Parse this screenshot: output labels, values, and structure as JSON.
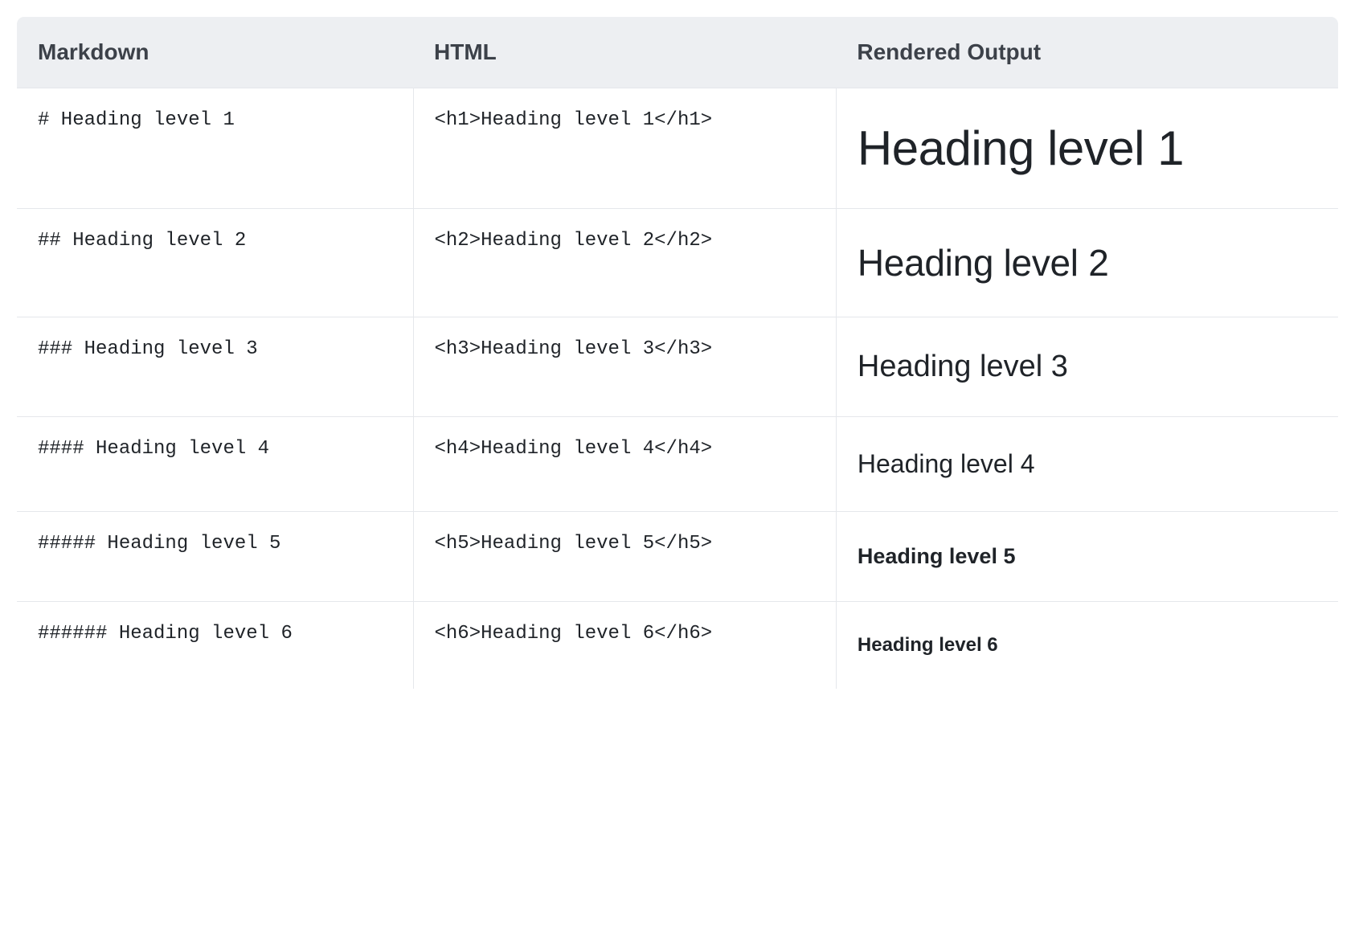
{
  "table": {
    "headers": [
      "Markdown",
      "HTML",
      "Rendered Output"
    ],
    "rows": [
      {
        "markdown": "# Heading level 1",
        "html": "<h1>Heading level 1</h1>",
        "rendered": "Heading level 1",
        "cls": "h1r"
      },
      {
        "markdown": "## Heading level 2",
        "html": "<h2>Heading level 2</h2>",
        "rendered": "Heading level 2",
        "cls": "h2r"
      },
      {
        "markdown": "### Heading level 3",
        "html": "<h3>Heading level 3</h3>",
        "rendered": "Heading level 3",
        "cls": "h3r"
      },
      {
        "markdown": "#### Heading level 4",
        "html": "<h4>Heading level 4</h4>",
        "rendered": "Heading level 4",
        "cls": "h4r"
      },
      {
        "markdown": "##### Heading level 5",
        "html": "<h5>Heading level 5</h5>",
        "rendered": "Heading level 5",
        "cls": "h5r"
      },
      {
        "markdown": "###### Heading level 6",
        "html": "<h6>Heading level 6</h6>",
        "rendered": "Heading level 6",
        "cls": "h6r"
      }
    ]
  }
}
